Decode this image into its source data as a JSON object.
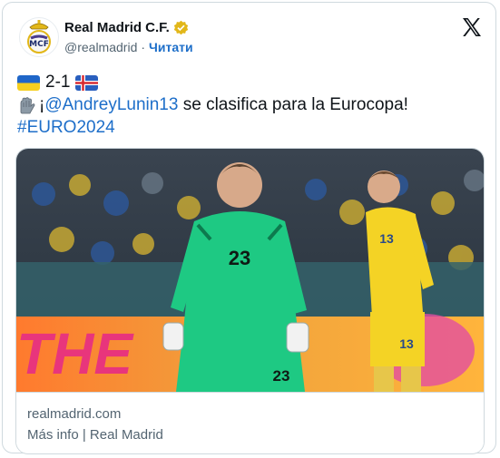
{
  "account": {
    "display_name": "Real Madrid C.F.",
    "handle": "@realmadrid",
    "separator": "·",
    "follow_label": "Читати",
    "verified_color": "#e2b719"
  },
  "tweet": {
    "score": "2-1",
    "prefix": "¡",
    "mention": "@AndreyLunin13",
    "body_text": " se clasifica para la Eurocopa!",
    "hashtag": "#EURO2024"
  },
  "card": {
    "domain": "realmadrid.com",
    "title": "Más info | Real Madrid"
  },
  "media": {
    "banner_text": "THE",
    "goalkeeper_number": "23",
    "player_number": "13"
  },
  "icons": [
    "real-madrid-crest",
    "verified-badge",
    "x-logo",
    "ukraine-flag",
    "iceland-flag",
    "gloves-emoji"
  ],
  "colors": {
    "link": "#1d6ec9",
    "muted": "#536471",
    "border": "#cfd9de"
  }
}
